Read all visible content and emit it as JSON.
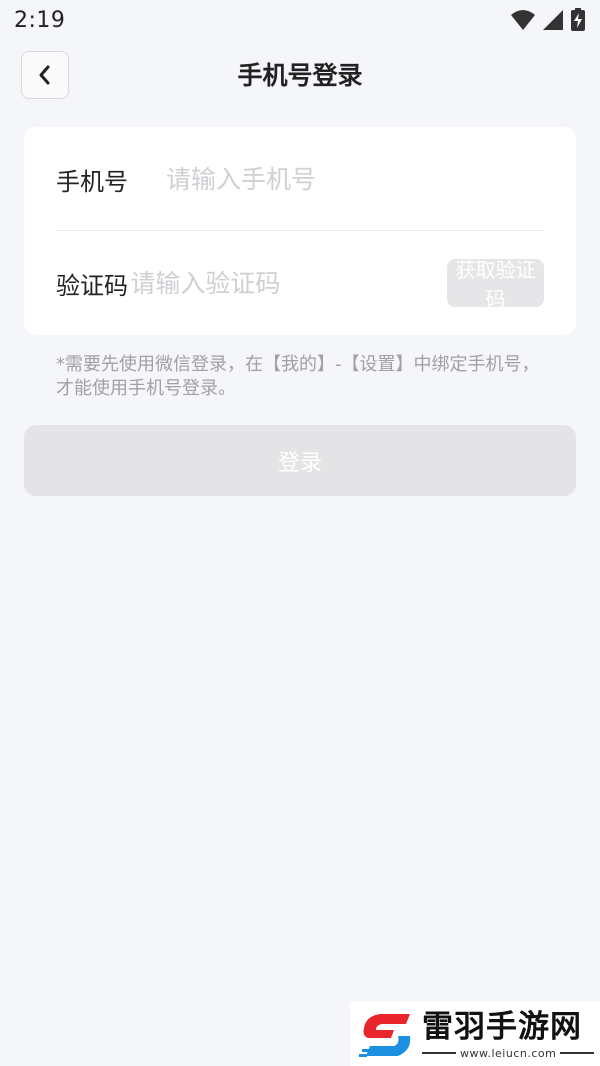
{
  "status_bar": {
    "time": "2:19",
    "icons": [
      "wifi-icon",
      "signal-icon",
      "battery-charging-icon"
    ]
  },
  "header": {
    "title": "手机号登录",
    "back_icon": "chevron-left-icon"
  },
  "form": {
    "phone_label": "手机号",
    "phone_placeholder": "请输入手机号",
    "phone_value": "",
    "code_label": "验证码",
    "code_placeholder": "请输入验证码",
    "code_value": "",
    "get_code_label": "获取验证码"
  },
  "hint": "*需要先使用微信登录，在【我的】-【设置】中绑定手机号，才能使用手机号登录。",
  "login_label": "登录",
  "watermark": {
    "brand": "雷羽手游网",
    "url": "www.leiucn.com"
  },
  "colors": {
    "background": "#f5f6fa",
    "card": "#ffffff",
    "disabled_button": "#e4e4e6",
    "placeholder": "#cfcfd4",
    "hint": "#a0a0a6",
    "watermark_red": "#e8262b",
    "watermark_blue": "#1d8fe0"
  }
}
